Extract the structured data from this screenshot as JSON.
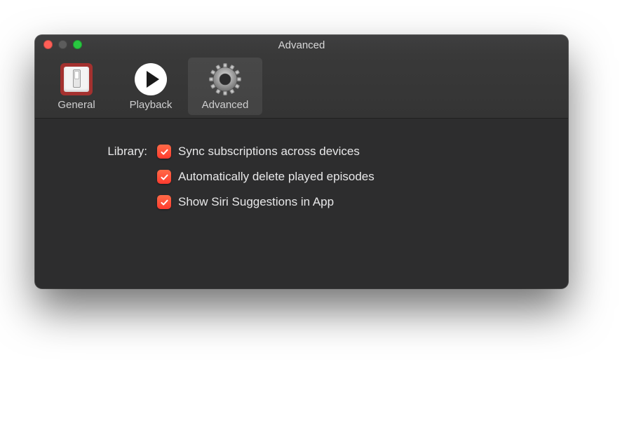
{
  "window": {
    "title": "Advanced"
  },
  "tabs": {
    "general": {
      "label": "General"
    },
    "playback": {
      "label": "Playback"
    },
    "advanced": {
      "label": "Advanced"
    }
  },
  "section": {
    "label": "Library:"
  },
  "options": {
    "sync": {
      "label": "Sync subscriptions across devices",
      "checked": true
    },
    "delete": {
      "label": "Automatically delete played episodes",
      "checked": true
    },
    "siri": {
      "label": "Show Siri Suggestions in App",
      "checked": true
    }
  }
}
